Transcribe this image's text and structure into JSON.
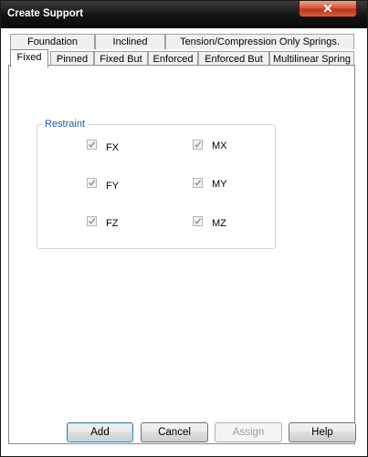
{
  "window": {
    "title": "Create Support",
    "close_label": "✕"
  },
  "tabs_row_back": [
    {
      "label": "Foundation"
    },
    {
      "label": "Inclined"
    },
    {
      "label": "Tension/Compression Only Springs."
    }
  ],
  "tabs_row_front": [
    {
      "label": "Fixed",
      "active": true
    },
    {
      "label": "Pinned"
    },
    {
      "label": "Fixed But"
    },
    {
      "label": "Enforced"
    },
    {
      "label": "Enforced But"
    },
    {
      "label": "Multilinear Spring"
    }
  ],
  "restraint": {
    "label": "Restraint",
    "items": [
      {
        "label": "FX",
        "checked": true,
        "disabled": true
      },
      {
        "label": "MX",
        "checked": true,
        "disabled": true
      },
      {
        "label": "FY",
        "checked": true,
        "disabled": true
      },
      {
        "label": "MY",
        "checked": true,
        "disabled": true
      },
      {
        "label": "FZ",
        "checked": true,
        "disabled": true
      },
      {
        "label": "MZ",
        "checked": true,
        "disabled": true
      }
    ]
  },
  "buttons": {
    "add": "Add",
    "cancel": "Cancel",
    "assign": "Assign",
    "help": "Help"
  },
  "colors": {
    "group_label": "#1e5aa8",
    "titlebar": "#141414",
    "close": "#c8452a"
  }
}
